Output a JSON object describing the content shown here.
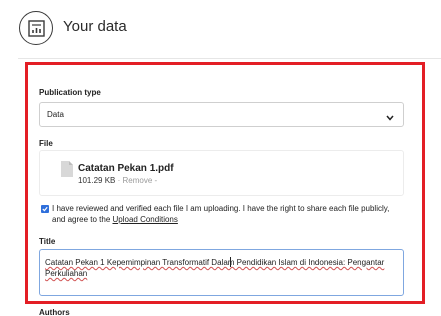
{
  "header": {
    "title": "Your data",
    "logo_icon": "report-chart-icon"
  },
  "form": {
    "publication_type_label": "Publication type",
    "publication_type_value": "Data",
    "file_label": "File",
    "file": {
      "name": "Catatan Pekan 1.pdf",
      "size": "101.29 KB",
      "separator": " · ",
      "remove_label": "Remove -"
    },
    "agreement_checked": true,
    "agreement_text": "I have reviewed and verified each file I am uploading. I have the right to share each file publicly, and agree to the ",
    "agreement_link": "Upload Conditions",
    "title_label": "Title",
    "title_value": "Catatan Pekan 1 Kepemimpinan Transformatif Dalam Pendidikan Islam di Indonesia: Pengantar Perkuliahan",
    "authors_label": "Authors"
  },
  "colors": {
    "highlight": "#e31e25",
    "checkbox": "#2f6fdb",
    "title_border": "#7fa7e0"
  }
}
